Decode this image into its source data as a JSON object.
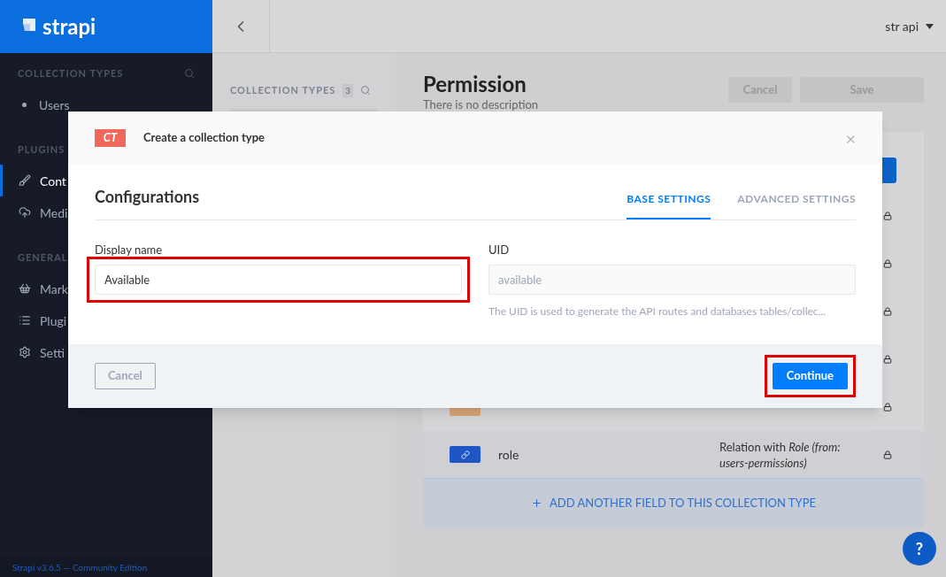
{
  "sidebar": {
    "logo": "strapi",
    "sections": [
      {
        "title": "COLLECTION TYPES",
        "search": true,
        "items": [
          {
            "label": "Users",
            "selected": false
          }
        ]
      },
      {
        "title": "PLUGINS",
        "items": [
          {
            "label": "Cont",
            "selected": true
          },
          {
            "label": "Medi",
            "selected": false
          }
        ]
      },
      {
        "title": "GENERAL",
        "items": [
          {
            "label": "Mark",
            "selected": false
          },
          {
            "label": "Plugi",
            "selected": false
          },
          {
            "label": "Setti",
            "selected": false
          }
        ]
      }
    ],
    "footer": "Strapi v3.6.5 — Community Edition"
  },
  "header": {
    "user": "str api"
  },
  "subnav": {
    "title": "COLLECTION TYPES",
    "count": "3"
  },
  "page": {
    "title": "Permission",
    "description": "There is no description",
    "buttons": [
      "Cancel",
      "Save"
    ],
    "rows": [
      {
        "kind": "covered"
      },
      {
        "kind": "covered"
      },
      {
        "kind": "covered"
      },
      {
        "kind": "covered"
      },
      {
        "kind": "text"
      },
      {
        "kind": "relation",
        "name": "role",
        "type": "Relation with *Role (from: users-permissions)*"
      }
    ],
    "add_field": "ADD ANOTHER FIELD TO THIS COLLECTION TYPE"
  },
  "help": "?",
  "modal": {
    "badge": "CT",
    "title": "Create a collection type",
    "close": "×",
    "heading": "Configurations",
    "tabs": [
      {
        "label": "BASE SETTINGS",
        "selected": true
      },
      {
        "label": "ADVANCED SETTINGS",
        "selected": false
      }
    ],
    "fields": [
      {
        "label": "Display name",
        "value": "Available",
        "disabled": false,
        "highlighted": true
      },
      {
        "label": "UID",
        "value": "available",
        "disabled": true,
        "highlighted": false,
        "hint": "The UID is used to generate the API routes and databases tables/collec..."
      }
    ],
    "cancel": "Cancel",
    "continue": {
      "label": "Continue",
      "highlighted": true
    }
  }
}
